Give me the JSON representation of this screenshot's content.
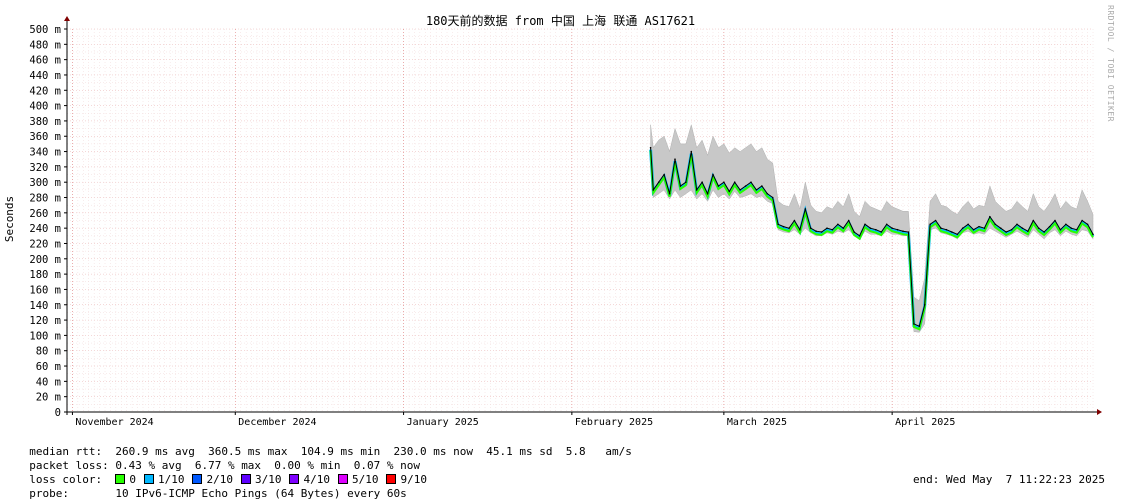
{
  "watermark": "RRDTOOL / TOBI OETIKER",
  "chart_data": {
    "type": "line",
    "title": "180天前的数据 from 中国 上海 联通 AS17621",
    "ylabel": "Seconds",
    "ylim": [
      0,
      500
    ],
    "ytick_labels": [
      "0",
      "20 m",
      "40 m",
      "60 m",
      "80 m",
      "100 m",
      "120 m",
      "140 m",
      "160 m",
      "180 m",
      "200 m",
      "220 m",
      "240 m",
      "260 m",
      "280 m",
      "300 m",
      "320 m",
      "340 m",
      "360 m",
      "380 m",
      "400 m",
      "420 m",
      "440 m",
      "460 m",
      "480 m",
      "500 m"
    ],
    "xtick_labels": [
      "November 2024",
      "December 2024",
      "January 2025",
      "February 2025",
      "March 2025",
      "April 2025"
    ],
    "xtick_days": [
      0,
      30,
      61,
      92,
      120,
      151
    ],
    "x_days_range": [
      -1,
      188
    ],
    "grid": true,
    "series": [
      {
        "name": "median rtt",
        "color": "#000000",
        "x_days": [
          106.5,
          107,
          108,
          109,
          110,
          111,
          112,
          113,
          114,
          115,
          116,
          117,
          118,
          119,
          120,
          121,
          122,
          123,
          124,
          125,
          126,
          127,
          128,
          129,
          130,
          131,
          132,
          133,
          134,
          135,
          136,
          137,
          138,
          139,
          140,
          141,
          142,
          143,
          144,
          145,
          146,
          147,
          148,
          149,
          150,
          151,
          152,
          153,
          154,
          155,
          156,
          157,
          158,
          159,
          160,
          161,
          162,
          163,
          164,
          165,
          166,
          167,
          168,
          169,
          170,
          171,
          172,
          173,
          174,
          175,
          176,
          177,
          178,
          179,
          180,
          181,
          182,
          183,
          184,
          185,
          186,
          187,
          188
        ],
        "median_ms": [
          345,
          290,
          300,
          310,
          285,
          330,
          295,
          300,
          340,
          290,
          300,
          285,
          310,
          295,
          300,
          288,
          300,
          290,
          295,
          300,
          290,
          295,
          285,
          280,
          245,
          242,
          240,
          250,
          238,
          265,
          240,
          236,
          235,
          240,
          238,
          245,
          240,
          250,
          235,
          230,
          245,
          240,
          238,
          235,
          245,
          240,
          238,
          236,
          235,
          115,
          112,
          140,
          245,
          250,
          240,
          238,
          235,
          232,
          240,
          245,
          238,
          242,
          240,
          255,
          245,
          240,
          235,
          238,
          245,
          240,
          236,
          250,
          240,
          235,
          242,
          250,
          238,
          245,
          240,
          238,
          250,
          245,
          232
        ],
        "min_ms": [
          330,
          280,
          285,
          290,
          278,
          290,
          280,
          285,
          290,
          278,
          285,
          275,
          290,
          280,
          285,
          278,
          288,
          280,
          282,
          285,
          280,
          282,
          275,
          272,
          238,
          235,
          234,
          238,
          232,
          240,
          234,
          230,
          230,
          234,
          232,
          236,
          234,
          238,
          230,
          226,
          236,
          232,
          232,
          230,
          236,
          232,
          232,
          230,
          230,
          105,
          104,
          115,
          238,
          240,
          234,
          232,
          230,
          226,
          234,
          236,
          232,
          234,
          232,
          240,
          236,
          232,
          228,
          232,
          236,
          232,
          228,
          238,
          232,
          226,
          234,
          238,
          230,
          236,
          232,
          230,
          238,
          236,
          226
        ],
        "max_ms": [
          375,
          345,
          355,
          360,
          340,
          370,
          350,
          350,
          375,
          345,
          355,
          335,
          360,
          345,
          350,
          338,
          345,
          340,
          345,
          350,
          340,
          345,
          330,
          325,
          275,
          270,
          268,
          285,
          265,
          300,
          270,
          262,
          260,
          268,
          265,
          275,
          268,
          285,
          262,
          255,
          275,
          268,
          265,
          262,
          275,
          268,
          265,
          262,
          262,
          150,
          145,
          175,
          275,
          285,
          270,
          268,
          262,
          258,
          268,
          275,
          265,
          270,
          268,
          295,
          275,
          268,
          262,
          265,
          275,
          268,
          262,
          285,
          268,
          262,
          272,
          285,
          265,
          275,
          268,
          265,
          290,
          275,
          258
        ]
      }
    ],
    "legend": [
      "0",
      "1/10",
      "2/10",
      "3/10",
      "4/10",
      "5/10",
      "9/10"
    ],
    "legend_colors": [
      "#26ff00",
      "#00b8ff",
      "#0059ff",
      "#5e00ff",
      "#7e00ff",
      "#dd00ff",
      "#ff0000"
    ]
  },
  "stats": {
    "rtt_label": "median rtt:",
    "rtt_values": "260.9 ms avg  360.5 ms max  104.9 ms min  230.0 ms now  45.1 ms sd  5.8   am/s",
    "loss_label": "packet loss:",
    "loss_values": "0.43 % avg  6.77 % max  0.00 % min  0.07 % now",
    "loss_color_label": "loss color:",
    "probe_label": "probe:",
    "probe_value": "10 IPv6-ICMP Echo Pings (64 Bytes) every 60s",
    "end": "end: Wed May  7 11:22:23 2025"
  }
}
